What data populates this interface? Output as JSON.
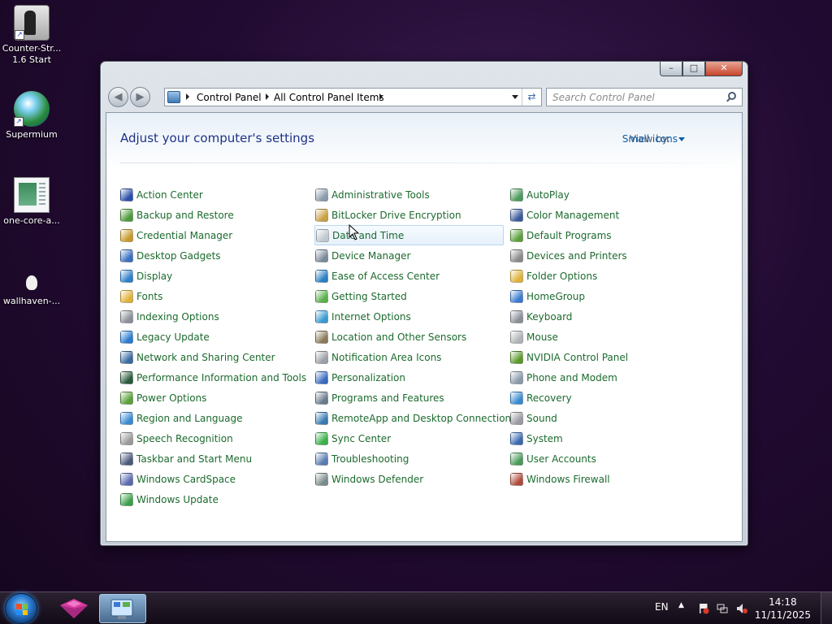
{
  "desktop": {
    "icons": [
      {
        "label": "Counter-Str... 1.6 Start"
      },
      {
        "label": "Supermium"
      },
      {
        "label": "one-core-a..."
      },
      {
        "label": "wallhaven-..."
      }
    ]
  },
  "window": {
    "address": {
      "crumbs": [
        "Control Panel",
        "All Control Panel Items"
      ]
    },
    "search": {
      "placeholder": "Search Control Panel"
    },
    "heading": "Adjust your computer's settings",
    "view_by": {
      "label": "View by:",
      "value": "Small icons"
    },
    "columns": [
      [
        {
          "label": "Action Center",
          "icon": "flag-icon",
          "color": "#2a4fa8"
        },
        {
          "label": "Backup and Restore",
          "icon": "backup-icon",
          "color": "#4a9a3a"
        },
        {
          "label": "Credential Manager",
          "icon": "vault-icon",
          "color": "#c89a2a"
        },
        {
          "label": "Desktop Gadgets",
          "icon": "gadgets-icon",
          "color": "#3a6fc0"
        },
        {
          "label": "Display",
          "icon": "display-icon",
          "color": "#2f7fc9"
        },
        {
          "label": "Fonts",
          "icon": "fonts-icon",
          "color": "#e0b23a"
        },
        {
          "label": "Indexing Options",
          "icon": "indexing-icon",
          "color": "#8a8f98"
        },
        {
          "label": "Legacy Update",
          "icon": "update-icon",
          "color": "#2a7ad0"
        },
        {
          "label": "Network and Sharing Center",
          "icon": "network-icon",
          "color": "#3a6aa0"
        },
        {
          "label": "Performance Information and Tools",
          "icon": "performance-icon",
          "color": "#2a5a3a"
        },
        {
          "label": "Power Options",
          "icon": "power-icon",
          "color": "#5aa03a"
        },
        {
          "label": "Region and Language",
          "icon": "globe-icon",
          "color": "#3a8ad0"
        },
        {
          "label": "Speech Recognition",
          "icon": "microphone-icon",
          "color": "#9a9a9a"
        },
        {
          "label": "Taskbar and Start Menu",
          "icon": "taskbar-icon",
          "color": "#4a5a7a"
        },
        {
          "label": "Windows CardSpace",
          "icon": "cardspace-icon",
          "color": "#5a6ab0"
        },
        {
          "label": "Windows Update",
          "icon": "windows-update-icon",
          "color": "#3aa04a"
        }
      ],
      [
        {
          "label": "Administrative Tools",
          "icon": "admin-tools-icon",
          "color": "#8a9aaa"
        },
        {
          "label": "BitLocker Drive Encryption",
          "icon": "bitlocker-icon",
          "color": "#c8a040"
        },
        {
          "label": "Date and Time",
          "icon": "clock-icon",
          "color": "#c0c8d0"
        },
        {
          "label": "Device Manager",
          "icon": "device-manager-icon",
          "color": "#7a8a9a"
        },
        {
          "label": "Ease of Access Center",
          "icon": "ease-of-access-icon",
          "color": "#2a80c0"
        },
        {
          "label": "Getting Started",
          "icon": "getting-started-icon",
          "color": "#5ab04a"
        },
        {
          "label": "Internet Options",
          "icon": "internet-icon",
          "color": "#3a9ad0"
        },
        {
          "label": "Location and Other Sensors",
          "icon": "sensors-icon",
          "color": "#8a7a5a"
        },
        {
          "label": "Notification Area Icons",
          "icon": "notification-icon",
          "color": "#9aa0a8"
        },
        {
          "label": "Personalization",
          "icon": "personalization-icon",
          "color": "#3a6ac0"
        },
        {
          "label": "Programs and Features",
          "icon": "programs-icon",
          "color": "#6a7a8a"
        },
        {
          "label": "RemoteApp and Desktop Connections",
          "icon": "remoteapp-icon",
          "color": "#3a7ab0"
        },
        {
          "label": "Sync Center",
          "icon": "sync-icon",
          "color": "#3ab04a"
        },
        {
          "label": "Troubleshooting",
          "icon": "troubleshooting-icon",
          "color": "#5a7ab0"
        },
        {
          "label": "Windows Defender",
          "icon": "defender-icon",
          "color": "#7a8a8a"
        }
      ],
      [
        {
          "label": "AutoPlay",
          "icon": "autoplay-icon",
          "color": "#4a9a5a"
        },
        {
          "label": "Color Management",
          "icon": "color-management-icon",
          "color": "#3a5a9a"
        },
        {
          "label": "Default Programs",
          "icon": "default-programs-icon",
          "color": "#5aa03a"
        },
        {
          "label": "Devices and Printers",
          "icon": "printer-icon",
          "color": "#8a8a8a"
        },
        {
          "label": "Folder Options",
          "icon": "folder-icon",
          "color": "#e0b23a"
        },
        {
          "label": "HomeGroup",
          "icon": "homegroup-icon",
          "color": "#3a7ad0"
        },
        {
          "label": "Keyboard",
          "icon": "keyboard-icon",
          "color": "#8a8f98"
        },
        {
          "label": "Mouse",
          "icon": "mouse-icon",
          "color": "#b0b4b8"
        },
        {
          "label": "NVIDIA Control Panel",
          "icon": "nvidia-icon",
          "color": "#5a9a2a"
        },
        {
          "label": "Phone and Modem",
          "icon": "phone-icon",
          "color": "#8a9aaa"
        },
        {
          "label": "Recovery",
          "icon": "recovery-icon",
          "color": "#3a8ad0"
        },
        {
          "label": "Sound",
          "icon": "speaker-icon",
          "color": "#9a9aa0"
        },
        {
          "label": "System",
          "icon": "system-icon",
          "color": "#3a6ab0"
        },
        {
          "label": "User Accounts",
          "icon": "user-accounts-icon",
          "color": "#4a9a5a"
        },
        {
          "label": "Windows Firewall",
          "icon": "firewall-icon",
          "color": "#b04a3a"
        }
      ]
    ],
    "hovered_item": "Date and Time"
  },
  "taskbar": {
    "language": "EN",
    "time": "14:18",
    "date": "11/11/2025"
  }
}
